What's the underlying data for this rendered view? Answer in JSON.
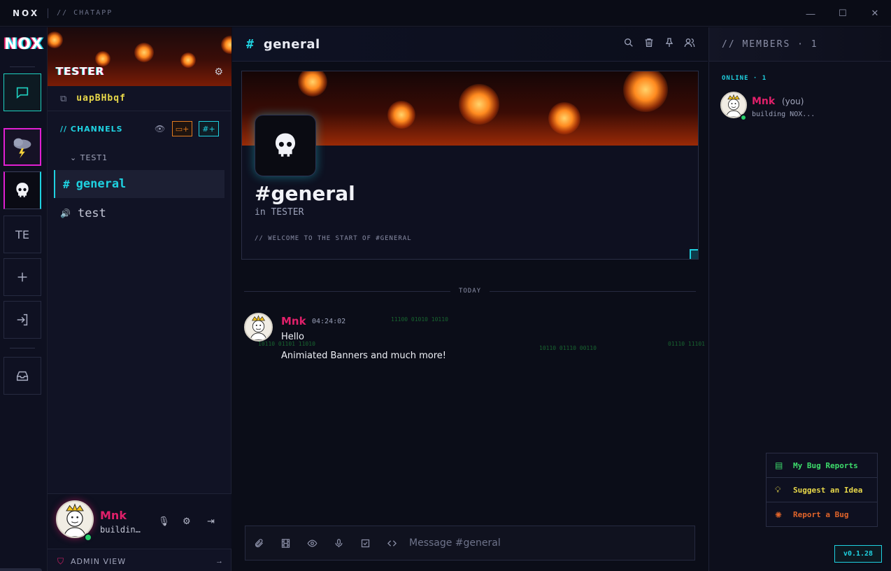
{
  "titlebar": {
    "brand": "NOX",
    "subtitle": "// CHATAPP"
  },
  "rail": {
    "logo": "NOX",
    "text_server": "TE"
  },
  "server": {
    "name": "TESTER",
    "invite_code": "uapBHbqf"
  },
  "channels": {
    "title": "// CHANNELS",
    "category": "TEST1",
    "items": [
      {
        "prefix": "#",
        "name": "general"
      },
      {
        "prefix": "🔊",
        "name": "test"
      }
    ]
  },
  "user_panel": {
    "username": "Mnk",
    "status": "buildin…"
  },
  "admin": {
    "label": "ADMIN VIEW",
    "arrow": "→"
  },
  "chat": {
    "hash": "#",
    "channel": "general",
    "welcome_title": "#general",
    "welcome_sub": "in TESTER",
    "welcome_note": "// WELCOME TO THE START OF #GENERAL",
    "divider": "TODAY",
    "message": {
      "author": "Mnk",
      "time": "04:24:02",
      "lines": [
        "Hello",
        "Animiated Banners and much more!"
      ]
    },
    "binary_strips": [
      "11100 01010 10110",
      "10110 01101 11010",
      "10110 01110 00110",
      "01110 11101"
    ],
    "composer_placeholder": "Message #general"
  },
  "members": {
    "title": "// MEMBERS · 1",
    "online_label": "ONLINE · 1",
    "member": {
      "name": "Mnk",
      "you": "(you)",
      "status": "building NOX..."
    }
  },
  "bug_panel": {
    "items": [
      {
        "label": "My Bug Reports",
        "color": "#3ddc6b"
      },
      {
        "label": "Suggest an Idea",
        "color": "#e8d84a"
      },
      {
        "label": "Report a Bug",
        "color": "#e0642a"
      }
    ]
  },
  "version": "v0.1.28",
  "colors": {
    "accent": "#1fd1e0",
    "magenta": "#e0206a",
    "online": "#27d06b"
  }
}
